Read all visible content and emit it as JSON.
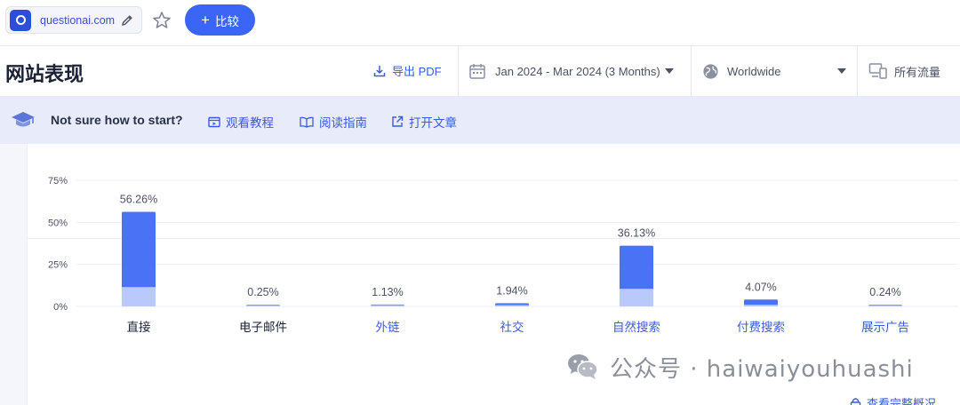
{
  "topbar": {
    "domain": "questionai.com",
    "compare_label": "比较",
    "compare_plus": "+"
  },
  "header": {
    "title": "网站表现",
    "export_label": "导出 PDF",
    "date_range": "Jan 2024 - Mar 2024 (3 Months)",
    "region": "Worldwide",
    "traffic_type": "所有流量"
  },
  "help": {
    "prompt": "Not sure how to start?",
    "links": [
      "观看教程",
      "阅读指南",
      "打开文章"
    ]
  },
  "chart_data": {
    "type": "bar",
    "categories": [
      "直接",
      "电子邮件",
      "外链",
      "社交",
      "自然搜索",
      "付费搜索",
      "展示广告"
    ],
    "values": [
      56.26,
      0.25,
      1.13,
      1.94,
      36.13,
      4.07,
      0.24
    ],
    "value_labels": [
      "56.26%",
      "0.25%",
      "1.13%",
      "1.94%",
      "36.13%",
      "4.07%",
      "0.24%"
    ],
    "inner_values": [
      11.5,
      0.2,
      0.5,
      0.8,
      10.5,
      1.0,
      0.15
    ],
    "yticks": [
      0,
      25,
      50,
      75
    ],
    "ytick_labels": [
      "0%",
      "25%",
      "50%",
      "75%"
    ],
    "ylim": [
      0,
      75
    ],
    "category_colors": [
      "#1b2236",
      "#1b2236",
      "#3b5bdb",
      "#3b5bdb",
      "#3b5bdb",
      "#3b5bdb",
      "#3b5bdb"
    ],
    "colors": {
      "bar": "#4a72f5",
      "bar_inner": "#b9c9fb",
      "grid": "#eceef4"
    }
  },
  "watermark": {
    "text": "公众号 · haiwaiyouhuashi"
  },
  "footer": {
    "full_overview": "查看完整概况"
  },
  "colors": {
    "accent": "#3b66f5",
    "link": "#3b5bdb",
    "banner_bg": "#e7ebfa"
  }
}
